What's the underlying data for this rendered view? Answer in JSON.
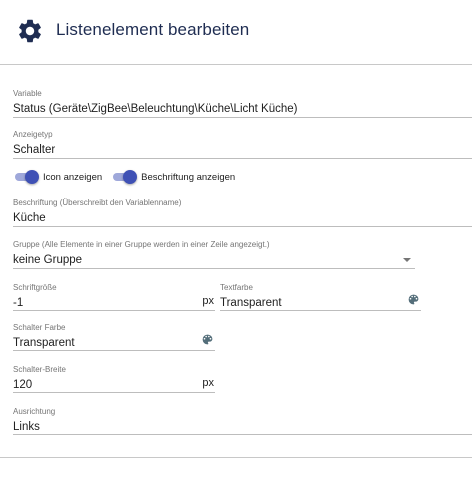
{
  "dialog": {
    "title": "Listenelement bearbeiten",
    "icon": "gear-icon"
  },
  "fields": {
    "variable": {
      "label": "Variable",
      "value": "Status (Geräte\\ZigBee\\Beleuchtung\\Küche\\Licht Küche)"
    },
    "anzeigetyp": {
      "label": "Anzeigetyp",
      "value": "Schalter"
    },
    "toggles": {
      "icon": {
        "label": "Icon anzeigen",
        "checked": true
      },
      "beschriftung": {
        "label": "Beschriftung anzeigen",
        "checked": true
      }
    },
    "beschriftung": {
      "label": "Beschriftung (Überschreibt den Variablenname)",
      "value": "Küche"
    },
    "gruppe": {
      "label": "Gruppe (Alle Elemente in einer Gruppe werden in einer Zeile angezeigt.)",
      "value": "keine Gruppe"
    },
    "schriftgroesse": {
      "label": "Schriftgröße",
      "value": "-1",
      "suffix": "px"
    },
    "textfarbe": {
      "label": "Textfarbe",
      "value": "Transparent",
      "icon": "palette-icon"
    },
    "schalter_farbe": {
      "label": "Schalter Farbe",
      "value": "Transparent",
      "icon": "palette-icon"
    },
    "schalter_breite": {
      "label": "Schalter-Breite",
      "value": "120",
      "suffix": "px"
    },
    "ausrichtung": {
      "label": "Ausrichtung",
      "value": "Links"
    }
  },
  "colors": {
    "accent": "#3f51b5",
    "accent_track": "#9fa8da",
    "title": "#1f2d52",
    "icon": "#1f2d52"
  }
}
